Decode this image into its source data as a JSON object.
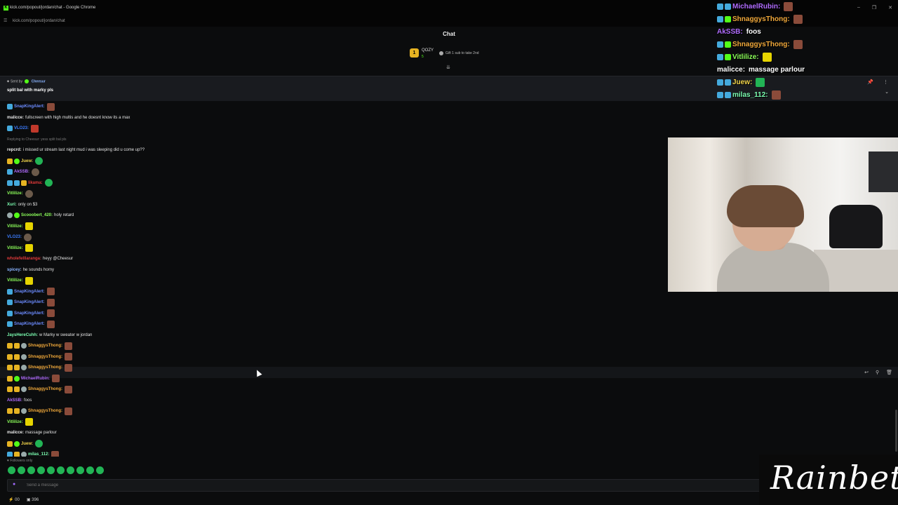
{
  "window": {
    "title": "kick.com/popout/jordan/chat - Google Chrome",
    "url": "kick.com/popout/jordan/chat"
  },
  "chat": {
    "title": "Chat",
    "gifter": {
      "rank": "1",
      "name": "QOZY",
      "count": "5"
    },
    "gift_prompt": "Gift 1 sub to take 2nd",
    "pinned": {
      "sent_by_label": "Sent by",
      "user": "Cheesur",
      "message": "split bal with marky pls"
    },
    "messages": [
      {
        "user": "SnapKingAlert:",
        "color": "#6c8cff",
        "text": ""
      },
      {
        "user": "malicce:",
        "color": "#e8e8e8",
        "text": "fullscreen with high multis and he doesnt know its a max"
      },
      {
        "user": "VLO23:",
        "color": "#3c7dff",
        "text": ""
      },
      {
        "reply": "Replying to Cheesur: yess split bal pls"
      },
      {
        "user": "repcrd:",
        "color": "#e8e8e8",
        "text": "i missed ur stream last night mud i was sleeping did u come up??"
      },
      {
        "user": "Juew:",
        "color": "#f0d34a",
        "text": ""
      },
      {
        "user": "AkSSB:",
        "color": "#b06cff",
        "text": ""
      },
      {
        "user": "likama:",
        "color": "#e03a3a",
        "text": ""
      },
      {
        "user": "Vitlilize:",
        "color": "#8cff5a",
        "text": ""
      },
      {
        "user": "Xuri:",
        "color": "#7cffb2",
        "text": "only on $3"
      },
      {
        "user": "Scooobert_420:",
        "color": "#8cff5a",
        "text": "holy retard"
      },
      {
        "user": "Vitlilize:",
        "color": "#8cff5a",
        "text": ""
      },
      {
        "user": "VLO23:",
        "color": "#3c7dff",
        "text": ""
      },
      {
        "user": "Vitlilize:",
        "color": "#8cff5a",
        "text": ""
      },
      {
        "user": "wholefelllaranga:",
        "color": "#e03a3a",
        "text": "heyy @Cheesur"
      },
      {
        "user": "spicey:",
        "color": "#8ab4ff",
        "text": "he sounds horny"
      },
      {
        "user": "Vitlilize:",
        "color": "#8cff5a",
        "text": ""
      },
      {
        "user": "SnapKingAlert:",
        "color": "#6c8cff",
        "text": ""
      },
      {
        "user": "SnapKingAlert:",
        "color": "#6c8cff",
        "text": ""
      },
      {
        "user": "SnapKingAlert:",
        "color": "#6c8cff",
        "text": ""
      },
      {
        "user": "SnapKingAlert:",
        "color": "#6c8cff",
        "text": ""
      },
      {
        "user": "JaysHereCuhh:",
        "color": "#7cffb2",
        "text": "w Marky w sweater w jordan"
      },
      {
        "user": "ShnaggysThong:",
        "color": "#f0a83a",
        "text": ""
      },
      {
        "user": "ShnaggysThong:",
        "color": "#f0a83a",
        "text": ""
      },
      {
        "user": "ShnaggysThong:",
        "color": "#f0a83a",
        "text": ""
      },
      {
        "user": "MichaelRubin:",
        "color": "#b06cff",
        "text": ""
      },
      {
        "user": "ShnaggysThong:",
        "color": "#f0a83a",
        "text": ""
      },
      {
        "user": "AkSSB:",
        "color": "#b06cff",
        "text": "foos"
      },
      {
        "user": "ShnaggysThong:",
        "color": "#f0a83a",
        "text": ""
      },
      {
        "user": "Vitlilize:",
        "color": "#8cff5a",
        "text": ""
      },
      {
        "user": "malicce:",
        "color": "#e8e8e8",
        "text": "massage parlour"
      },
      {
        "user": "Juew:",
        "color": "#f0d34a",
        "text": ""
      },
      {
        "user": "milas_112:",
        "color": "#7cffb2",
        "text": ""
      }
    ],
    "followers_only": "Followers only",
    "input_placeholder": "Send a message",
    "footer": {
      "points": "00",
      "viewers": "396"
    }
  },
  "overlay": [
    {
      "user": "MichaelRubin:",
      "color": "#b06cff",
      "text": ""
    },
    {
      "user": "ShnaggysThong:",
      "color": "#f0a83a",
      "text": ""
    },
    {
      "user": "AkSSB:",
      "color": "#b06cff",
      "text": "foos"
    },
    {
      "user": "ShnaggysThong:",
      "color": "#f0a83a",
      "text": ""
    },
    {
      "user": "Vitlilize:",
      "color": "#8cff5a",
      "text": ""
    },
    {
      "user": "malicce:",
      "color": "#ffffff",
      "text": "massage parlour"
    },
    {
      "user": "Juew:",
      "color": "#f0d34a",
      "text": ""
    },
    {
      "user": "milas_112:",
      "color": "#7cffb2",
      "text": ""
    }
  ],
  "sponsor": {
    "name": "Rainbet"
  },
  "colors": {
    "kick_green": "#53fc18",
    "background": "#0b0c0d"
  }
}
